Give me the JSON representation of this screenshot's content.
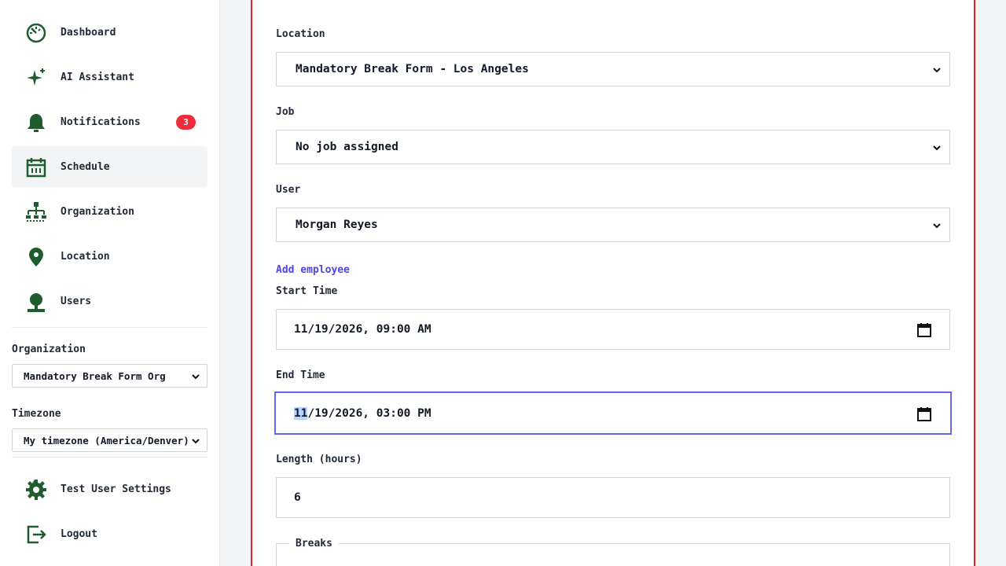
{
  "sidebar": {
    "items": [
      {
        "label": "Dashboard",
        "icon": "dashboard-icon"
      },
      {
        "label": "AI Assistant",
        "icon": "sparkle-icon"
      },
      {
        "label": "Notifications",
        "icon": "bell-icon",
        "badge": "3"
      },
      {
        "label": "Schedule",
        "icon": "calendar-icon",
        "active": true
      },
      {
        "label": "Organization",
        "icon": "org-chart-icon"
      },
      {
        "label": "Location",
        "icon": "map-pin-icon"
      },
      {
        "label": "Users",
        "icon": "user-icon"
      }
    ],
    "organization": {
      "label": "Organization",
      "value": "Mandatory Break Form Org"
    },
    "timezone": {
      "label": "Timezone",
      "value": "My timezone (America/Denver)"
    },
    "bottom": [
      {
        "label": "Test User Settings",
        "icon": "gear-icon"
      },
      {
        "label": "Logout",
        "icon": "logout-icon"
      }
    ]
  },
  "form": {
    "location": {
      "label": "Location",
      "value": "Mandatory Break Form - Los Angeles"
    },
    "job": {
      "label": "Job",
      "value": "No job assigned"
    },
    "user": {
      "label": "User",
      "value": "Morgan Reyes"
    },
    "add_employee": "Add employee",
    "start_time": {
      "label": "Start Time",
      "value": "11/19/2026, 09:00 AM"
    },
    "end_time": {
      "label": "End Time",
      "value_highlight": "11",
      "value_rest": "/19/2026, 03:00 PM"
    },
    "length": {
      "label": "Length (hours)",
      "value": "6"
    },
    "breaks": {
      "legend": "Breaks"
    }
  },
  "colors": {
    "icon": "#1f5c2e",
    "accent": "#6366f1",
    "danger_border": "#e0262c",
    "badge": "#ef2b3c",
    "link": "#4f46e5"
  }
}
